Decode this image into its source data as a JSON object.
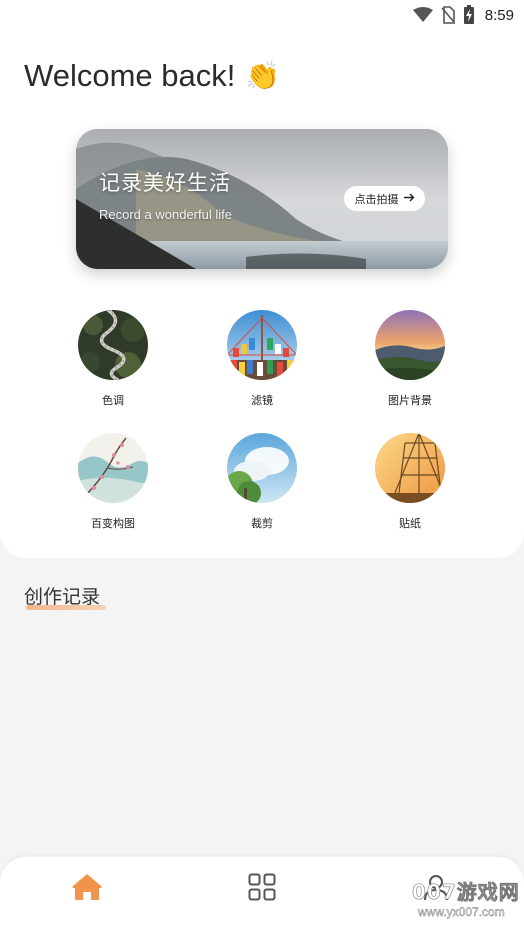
{
  "status_bar": {
    "time": "8:59",
    "icons": [
      "wifi-icon",
      "no-sim-icon",
      "battery-charging-icon"
    ]
  },
  "header": {
    "greeting": "Welcome back!",
    "emoji": "👏"
  },
  "banner": {
    "title": "记录美好生活",
    "subtitle": "Record a wonderful life",
    "button_label": "点击拍摄",
    "button_icon": "arrow-right-icon"
  },
  "features": [
    {
      "label": "色调",
      "icon": "winding-road-thumbnail"
    },
    {
      "label": "滤镜",
      "icon": "prayer-flags-thumbnail"
    },
    {
      "label": "图片背景",
      "icon": "sunset-hills-thumbnail"
    },
    {
      "label": "百变构图",
      "icon": "blossom-painting-thumbnail"
    },
    {
      "label": "裁剪",
      "icon": "sky-tree-thumbnail"
    },
    {
      "label": "贴纸",
      "icon": "golden-ship-thumbnail"
    }
  ],
  "records": {
    "title": "创作记录"
  },
  "bottom_nav": {
    "items": [
      {
        "name": "home",
        "icon": "home-icon",
        "active": true
      },
      {
        "name": "grid",
        "icon": "grid-icon",
        "active": false
      },
      {
        "name": "profile",
        "icon": "user-icon",
        "active": false
      }
    ]
  },
  "watermark": {
    "name": "007游戏网",
    "url": "www.yx007.com"
  },
  "colors": {
    "accent": "#f0944b",
    "background": "#f4f4f4",
    "card": "#ffffff"
  }
}
